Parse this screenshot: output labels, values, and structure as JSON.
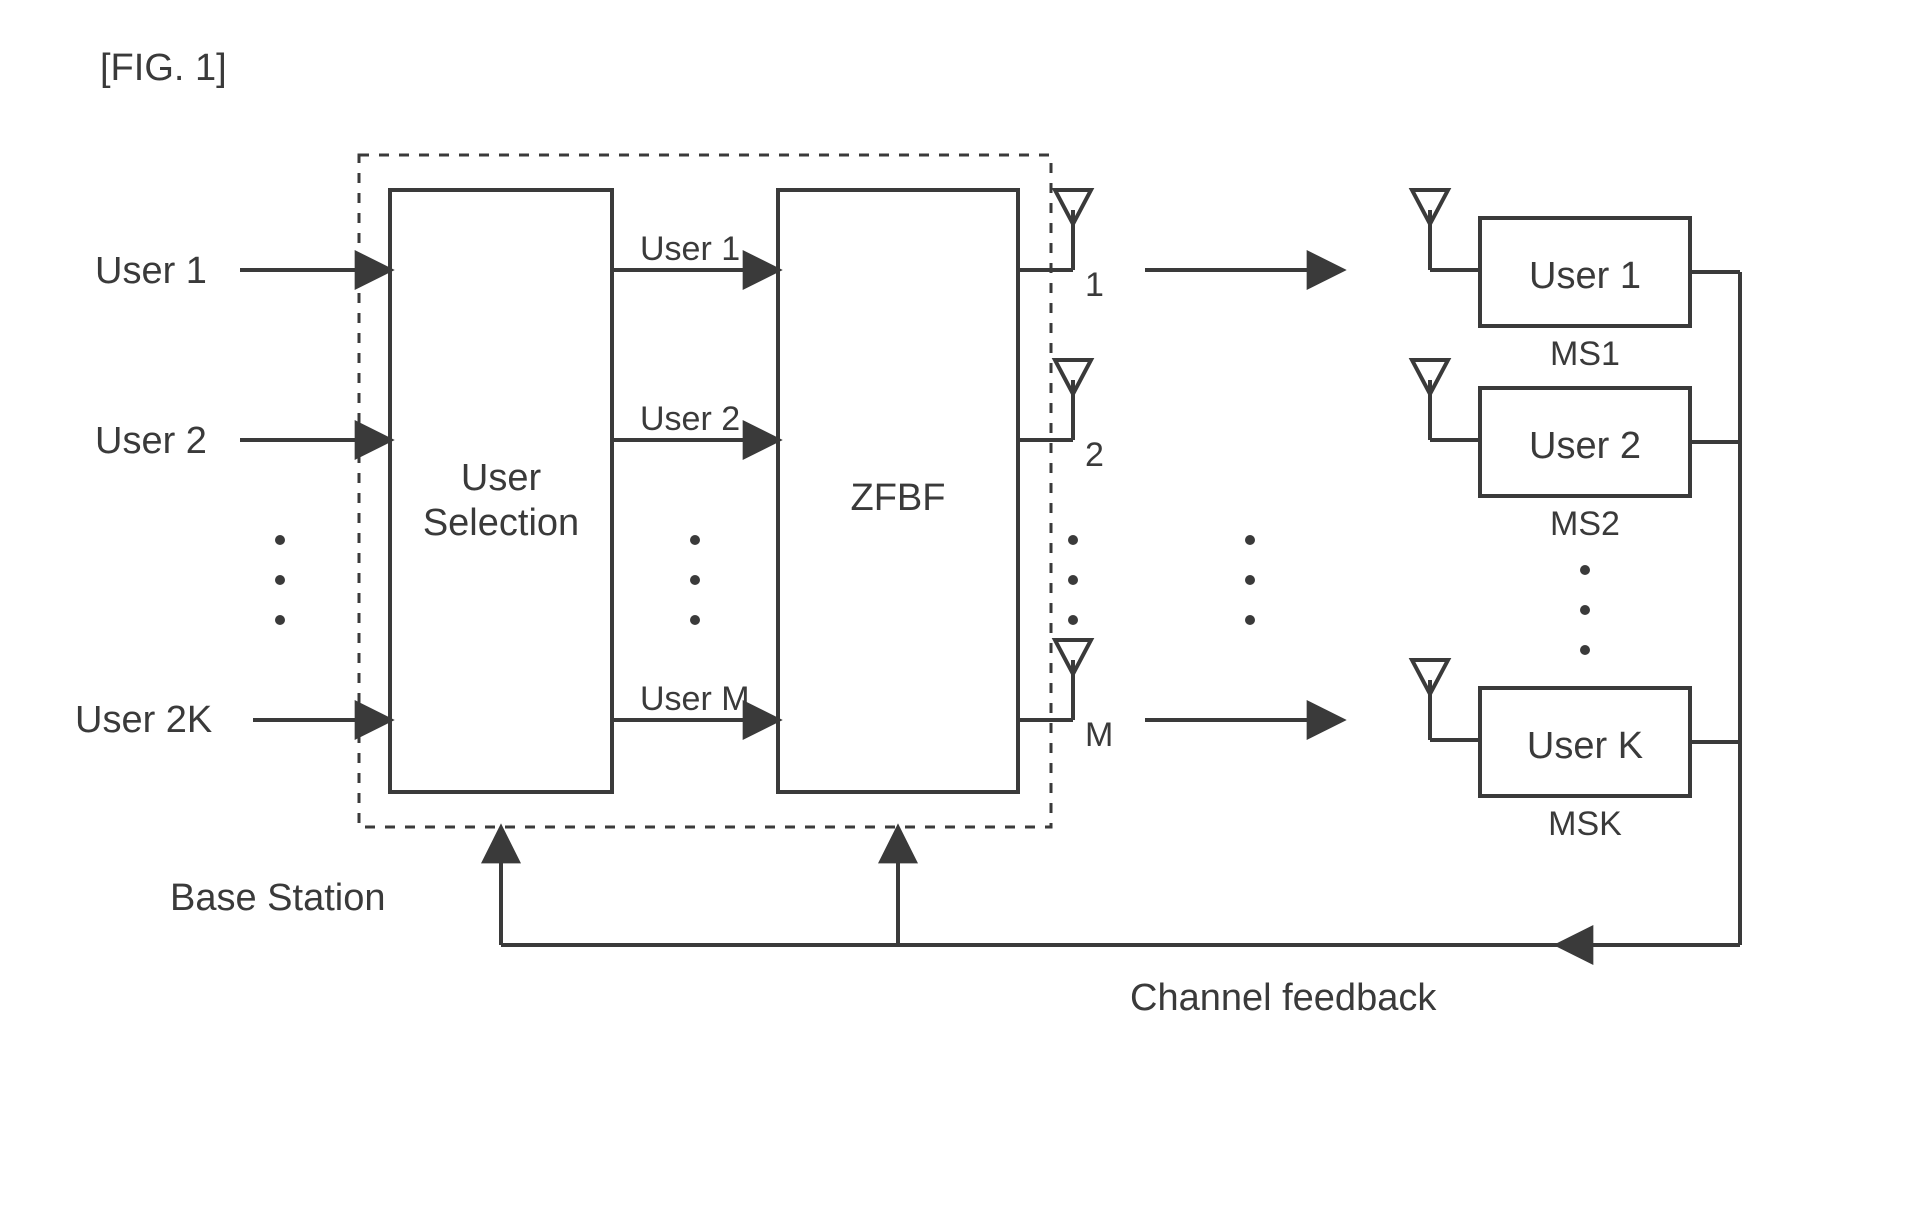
{
  "figure_label": "[FIG. 1]",
  "inputs": {
    "u1": "User 1",
    "u2": "User 2",
    "uk": "User 2K"
  },
  "sel_block": {
    "line1": "User",
    "line2": "Selection"
  },
  "zfbf": "ZFBF",
  "mid": {
    "u1": "User 1",
    "u2": "User 2",
    "um": "User M"
  },
  "ant": {
    "a1": "1",
    "a2": "2",
    "am": "M"
  },
  "ms": {
    "u1": "User 1",
    "u2": "User 2",
    "uk": "User K",
    "l1": "MS1",
    "l2": "MS2",
    "lk": "MSK"
  },
  "base": "Base Station",
  "feedback": "Channel feedback"
}
